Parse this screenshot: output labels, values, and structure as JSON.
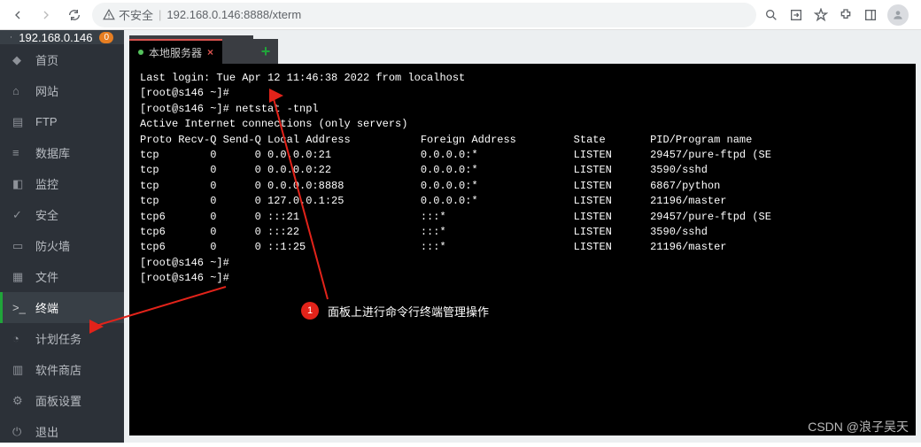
{
  "browser": {
    "insecure_label": "不安全",
    "url": "192.168.0.146:8888/xterm"
  },
  "sidebar": {
    "host": "192.168.0.146",
    "badge": "0",
    "items": [
      {
        "label": "首页"
      },
      {
        "label": "网站"
      },
      {
        "label": "FTP"
      },
      {
        "label": "数据库"
      },
      {
        "label": "监控"
      },
      {
        "label": "安全"
      },
      {
        "label": "防火墙"
      },
      {
        "label": "文件"
      },
      {
        "label": "终端"
      },
      {
        "label": "计划任务"
      },
      {
        "label": "软件商店"
      },
      {
        "label": "面板设置"
      },
      {
        "label": "退出"
      }
    ],
    "active_index": 8
  },
  "tabs": {
    "active": "本地服务器",
    "add": "+"
  },
  "terminal": {
    "lines": [
      "Last login: Tue Apr 12 11:46:38 2022 from localhost",
      "[root@s146 ~]#",
      "[root@s146 ~]# netstat -tnpl",
      "Active Internet connections (only servers)",
      "Proto Recv-Q Send-Q Local Address           Foreign Address         State       PID/Program name",
      "tcp        0      0 0.0.0.0:21              0.0.0.0:*               LISTEN      29457/pure-ftpd (SE",
      "tcp        0      0 0.0.0.0:22              0.0.0.0:*               LISTEN      3590/sshd",
      "tcp        0      0 0.0.0.0:8888            0.0.0.0:*               LISTEN      6867/python",
      "tcp        0      0 127.0.0.1:25            0.0.0.0:*               LISTEN      21196/master",
      "tcp6       0      0 :::21                   :::*                    LISTEN      29457/pure-ftpd (SE",
      "tcp6       0      0 :::22                   :::*                    LISTEN      3590/sshd",
      "tcp6       0      0 ::1:25                  :::*                    LISTEN      21196/master",
      "[root@s146 ~]#",
      "[root@s146 ~]#"
    ]
  },
  "callout": {
    "num": "1",
    "text": "面板上进行命令行终端管理操作"
  },
  "watermark": "CSDN @浪子吴天"
}
